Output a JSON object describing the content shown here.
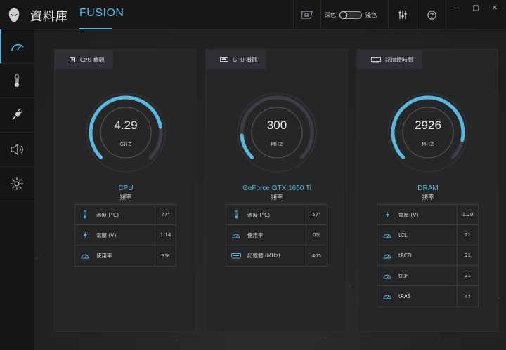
{
  "app": {
    "title": "資料庫",
    "tab": "FUSION"
  },
  "toolbar": {
    "theme_dark": "深色",
    "theme_light": "淺色"
  },
  "window": {
    "minimize": "—",
    "maximize": "□",
    "close": "✕"
  },
  "sidebar": {
    "items": [
      {
        "icon": "gauge-icon",
        "active": true
      },
      {
        "icon": "thermometer-icon",
        "active": false
      },
      {
        "icon": "power-plug-icon",
        "active": false
      },
      {
        "icon": "speaker-icon",
        "active": false
      },
      {
        "icon": "lighting-icon",
        "active": false
      }
    ]
  },
  "colors": {
    "accent": "#5ab8de",
    "track": "#3c3e41"
  },
  "panels": [
    {
      "tab_label": "CPU 概觀",
      "gauge_value": "4.29",
      "gauge_unit": "GHZ",
      "gauge_fraction": 0.8,
      "device": "CPU",
      "sub": "頻率",
      "stats": [
        {
          "icon": "thermometer-icon",
          "label": "溫度 (°C)",
          "value": "77°"
        },
        {
          "icon": "lightning-icon",
          "label": "電壓 (V)",
          "value": "1.14"
        },
        {
          "icon": "speedometer-icon",
          "label": "使用率",
          "value": "3%"
        }
      ]
    },
    {
      "tab_label": "GPU 概觀",
      "gauge_value": "300",
      "gauge_unit": "MHZ",
      "gauge_fraction": 0.15,
      "device": "GeForce GTX 1660 Ti",
      "sub": "頻率",
      "stats": [
        {
          "icon": "thermometer-icon",
          "label": "溫度 (°C)",
          "value": "57°"
        },
        {
          "icon": "speedometer-icon",
          "label": "使用率",
          "value": "0%"
        },
        {
          "icon": "memory-icon",
          "label": "記憶體 (MHz)",
          "value": "405"
        }
      ]
    },
    {
      "tab_label": "記憶體時脈",
      "gauge_value": "2926",
      "gauge_unit": "MHZ",
      "gauge_fraction": 0.88,
      "device": "DRAM",
      "sub": "頻率",
      "stats": [
        {
          "icon": "lightning-icon",
          "label": "電壓 (V)",
          "value": "1.20"
        },
        {
          "icon": "speedometer-icon",
          "label": "tCL",
          "value": "21"
        },
        {
          "icon": "speedometer-icon",
          "label": "tRCD",
          "value": "21"
        },
        {
          "icon": "speedometer-icon",
          "label": "tRP",
          "value": "21"
        },
        {
          "icon": "speedometer-icon",
          "label": "tRAS",
          "value": "47"
        }
      ]
    }
  ]
}
